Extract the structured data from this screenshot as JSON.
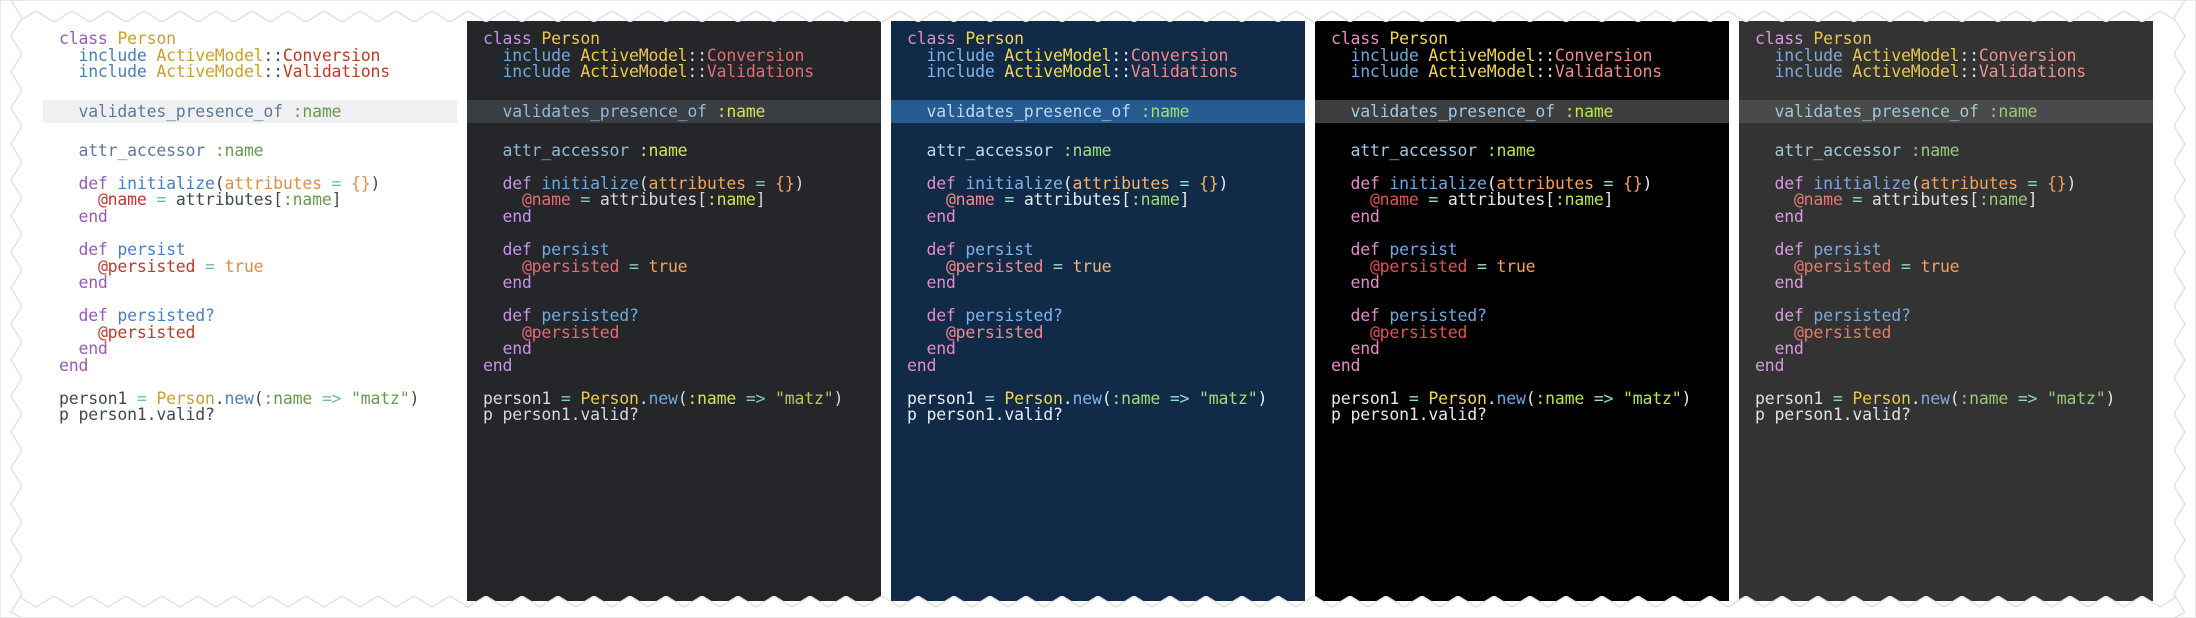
{
  "frame": {
    "style": "torn-zigzag-paper-border",
    "background": "#ffffff"
  },
  "panel_count": 5,
  "shared_code": {
    "language": "ruby",
    "highlighted_line_index": 3,
    "highlighted_line_text": "validates_presence_of :name",
    "lines": [
      [
        {
          "t": "class ",
          "c": "kw"
        },
        {
          "t": "Person",
          "c": "cls"
        }
      ],
      [
        {
          "t": "  ",
          "c": "pl"
        },
        {
          "t": "include ",
          "c": "fn"
        },
        {
          "t": "ActiveModel",
          "c": "cls"
        },
        {
          "t": "::",
          "c": "pl"
        },
        {
          "t": "Conversion",
          "c": "mod"
        }
      ],
      [
        {
          "t": "  ",
          "c": "pl"
        },
        {
          "t": "include ",
          "c": "fn"
        },
        {
          "t": "ActiveModel",
          "c": "cls"
        },
        {
          "t": "::",
          "c": "pl"
        },
        {
          "t": "Validations",
          "c": "mod"
        }
      ],
      [],
      [
        {
          "t": "  ",
          "c": "pl"
        },
        {
          "t": "validates_presence_of ",
          "c": "meth"
        },
        {
          "t": ":name",
          "c": "sym"
        }
      ],
      [],
      [
        {
          "t": "  ",
          "c": "pl"
        },
        {
          "t": "attr_accessor ",
          "c": "meth"
        },
        {
          "t": ":name",
          "c": "sym"
        }
      ],
      [],
      [
        {
          "t": "  ",
          "c": "pl"
        },
        {
          "t": "def ",
          "c": "kw"
        },
        {
          "t": "initialize",
          "c": "fn"
        },
        {
          "t": "(",
          "c": "pl"
        },
        {
          "t": "attributes",
          "c": "num"
        },
        {
          "t": " = ",
          "c": "op"
        },
        {
          "t": "{}",
          "c": "num"
        },
        {
          "t": ")",
          "c": "pl"
        }
      ],
      [
        {
          "t": "    ",
          "c": "pl"
        },
        {
          "t": "@name",
          "c": "ivar"
        },
        {
          "t": " = ",
          "c": "op"
        },
        {
          "t": "attributes",
          "c": "pl"
        },
        {
          "t": "[",
          "c": "pl"
        },
        {
          "t": ":name",
          "c": "sym"
        },
        {
          "t": "]",
          "c": "pl"
        }
      ],
      [
        {
          "t": "  ",
          "c": "pl"
        },
        {
          "t": "end",
          "c": "kw"
        }
      ],
      [],
      [
        {
          "t": "  ",
          "c": "pl"
        },
        {
          "t": "def ",
          "c": "kw"
        },
        {
          "t": "persist",
          "c": "fn"
        }
      ],
      [
        {
          "t": "    ",
          "c": "pl"
        },
        {
          "t": "@persisted",
          "c": "ivar"
        },
        {
          "t": " = ",
          "c": "op"
        },
        {
          "t": "true",
          "c": "num"
        }
      ],
      [
        {
          "t": "  ",
          "c": "pl"
        },
        {
          "t": "end",
          "c": "kw"
        }
      ],
      [],
      [
        {
          "t": "  ",
          "c": "pl"
        },
        {
          "t": "def ",
          "c": "kw"
        },
        {
          "t": "persisted?",
          "c": "fn"
        }
      ],
      [
        {
          "t": "    ",
          "c": "pl"
        },
        {
          "t": "@persisted",
          "c": "ivar"
        }
      ],
      [
        {
          "t": "  ",
          "c": "pl"
        },
        {
          "t": "end",
          "c": "kw"
        }
      ],
      [
        {
          "t": "end",
          "c": "kw"
        }
      ],
      [],
      [
        {
          "t": "person1",
          "c": "pl"
        },
        {
          "t": " = ",
          "c": "op"
        },
        {
          "t": "Person",
          "c": "cls"
        },
        {
          "t": ".",
          "c": "pl"
        },
        {
          "t": "new",
          "c": "fn"
        },
        {
          "t": "(",
          "c": "pl"
        },
        {
          "t": ":name",
          "c": "sym"
        },
        {
          "t": " => ",
          "c": "op"
        },
        {
          "t": "\"matz\"",
          "c": "str"
        },
        {
          "t": ")",
          "c": "pl"
        }
      ],
      [
        {
          "t": "p person1",
          "c": "pl"
        },
        {
          "t": ".",
          "c": "pl"
        },
        {
          "t": "valid?",
          "c": "pl"
        }
      ]
    ]
  },
  "panels": [
    {
      "id": "panel-1",
      "theme_name": "light",
      "background": "#ffffff",
      "highlight_background": "#f0f0f0",
      "foreground": "#3f4b54"
    },
    {
      "id": "panel-2",
      "theme_name": "dark-charcoal",
      "background": "#24262a",
      "highlight_background": "#3a3d42",
      "foreground": "#d5d8dc"
    },
    {
      "id": "panel-3",
      "theme_name": "navy-blue",
      "background": "#102a47",
      "highlight_background": "#255a92",
      "foreground": "#e6ecf2"
    },
    {
      "id": "panel-4",
      "theme_name": "black",
      "background": "#000000",
      "highlight_background": "#3d3d3d",
      "foreground": "#e8e8e8"
    },
    {
      "id": "panel-5",
      "theme_name": "dark-gray",
      "background": "#333333",
      "highlight_background": "#4a4a4a",
      "foreground": "#e0e0e0"
    }
  ]
}
